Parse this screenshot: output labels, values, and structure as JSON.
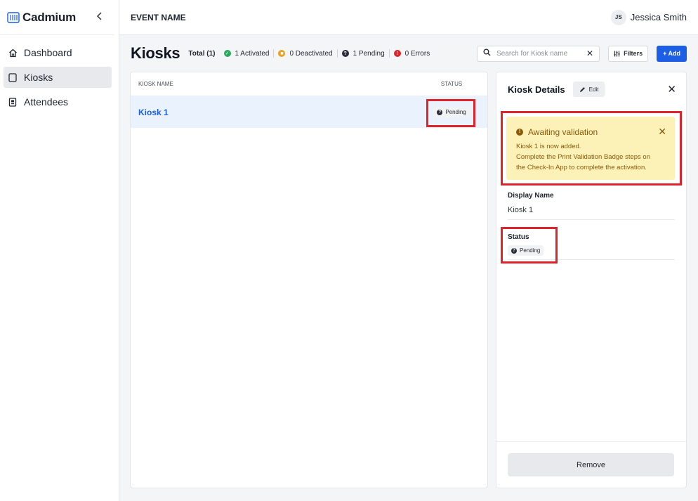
{
  "app": {
    "brand": "Cadmium",
    "collapse_icon": "chevron-left-icon"
  },
  "sidebar": {
    "items": [
      {
        "label": "Dashboard",
        "icon": "home-icon",
        "active": false
      },
      {
        "label": "Kiosks",
        "icon": "tablet-icon",
        "active": true
      },
      {
        "label": "Attendees",
        "icon": "badge-icon",
        "active": false
      }
    ]
  },
  "topbar": {
    "event_name": "EVENT NAME",
    "user_initials": "JS",
    "user_name": "Jessica Smith"
  },
  "page": {
    "title": "Kiosks",
    "stats": {
      "total": "Total (1)",
      "activated": "1 Activated",
      "deactivated": "0 Deactivated",
      "pending": "1 Pending",
      "errors": "0 Errors"
    },
    "search": {
      "placeholder": "Search for Kiosk name",
      "value": ""
    },
    "filters_label": "Filters",
    "add_label": "+ Add"
  },
  "colors": {
    "accent": "#1d5ee6",
    "activated": "#2aa961",
    "deactivated": "#e8a21b",
    "pending": "#2a2e38",
    "errors": "#e0232a",
    "warning_bg": "#fcf2b7",
    "warning_text": "#8a5a0b",
    "highlight": "#e0232a"
  },
  "table": {
    "columns": {
      "name": "KIOSK NAME",
      "status": "STATUS"
    },
    "rows": [
      {
        "name": "Kiosk 1",
        "status": "Pending"
      }
    ]
  },
  "details": {
    "title": "Kiosk Details",
    "edit_label": "Edit",
    "alert": {
      "title": "Awaiting validation",
      "line1": "Kiosk 1 is now added.",
      "line2": "Complete the Print Validation Badge steps on",
      "line3": "the Check-In App to complete the activation."
    },
    "display_name_label": "Display Name",
    "display_name_value": "Kiosk 1",
    "status_label": "Status",
    "status_value": "Pending",
    "remove_label": "Remove"
  }
}
